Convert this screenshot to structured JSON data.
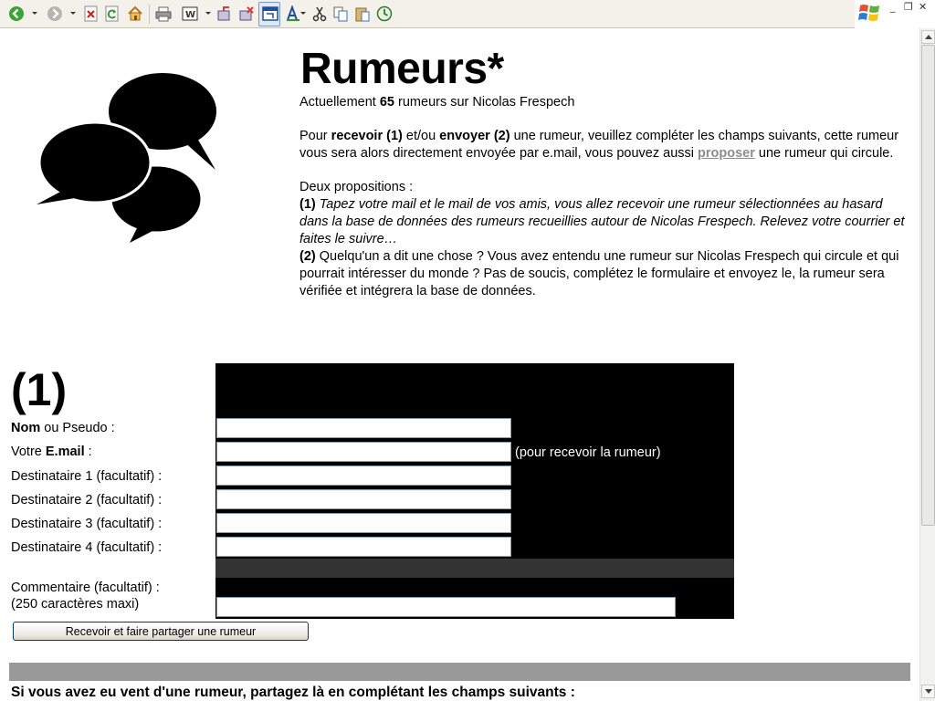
{
  "toolbar": {
    "icons": [
      "back-icon",
      "forward-icon",
      "stop-icon",
      "refresh-icon",
      "home-icon",
      "print-icon",
      "word-icon",
      "research-icon",
      "messenger-icon",
      "fullscreen-icon",
      "font-icon",
      "cut-icon",
      "copy-icon",
      "paste-icon",
      "history-icon"
    ]
  },
  "window": {
    "minimize": "_",
    "restore": "❐",
    "close": "✕"
  },
  "page": {
    "title": "Rumeurs*",
    "count_prefix": "Actuellement ",
    "count_value": "65",
    "count_suffix": " rumeurs sur Nicolas Frespech",
    "intro": {
      "t1": "Pour ",
      "b1": "recevoir (1)",
      "t2": " et/ou ",
      "b2": "envoyer (2)",
      "t3": " une rumeur, veuillez compléter les champs suivants, cette rumeur vous sera alors directement envoyée par e.mail, vous pouvez aussi ",
      "link": "proposer",
      "t4": " une rumeur qui circule."
    },
    "deux": "Deux propositions :",
    "prop1": {
      "num": "(1)",
      "text": " Tapez votre mail et le mail de vos amis, vous allez recevoir une rumeur sélectionnées au hasard dans la base de données des rumeurs recueillies autour de Nicolas Frespech. Relevez votre courrier et faites le suivre…"
    },
    "prop2": {
      "num": "(2)",
      "text": " Quelqu'un a dit une chose ? Vous avez entendu une rumeur sur Nicolas Frespech qui circule et qui pourrait intéresser du monde ? Pas de soucis, complétez le formulaire et envoyez le, la rumeur sera vérifiée et intégrera la base de données."
    }
  },
  "form1": {
    "number": "(1)",
    "nom_bold": "Nom",
    "nom_rest": " ou Pseudo :",
    "email_pre": "Votre ",
    "email_bold": "E.mail",
    "email_post": " :",
    "dest1": "Destinataire 1 (facultatif) :",
    "dest2": "Destinataire 2 (facultatif) :",
    "dest3": "Destinataire 3 (facultatif) :",
    "dest4": "Destinataire 4 (facultatif) :",
    "email_hint": "(pour recevoir la rumeur)",
    "comment_label": "Commentaire (facultatif) :",
    "comment_hint": "(250 caractères maxi)",
    "fields": {
      "nom": "",
      "email": "",
      "dest1": "",
      "dest2": "",
      "dest3": "",
      "dest4": "",
      "comment": ""
    },
    "submit": "Recevoir et faire partager une rumeur"
  },
  "form2": {
    "title": "Si vous avez eu vent d'une rumeur, partagez là en complétant les champs suivants :"
  }
}
